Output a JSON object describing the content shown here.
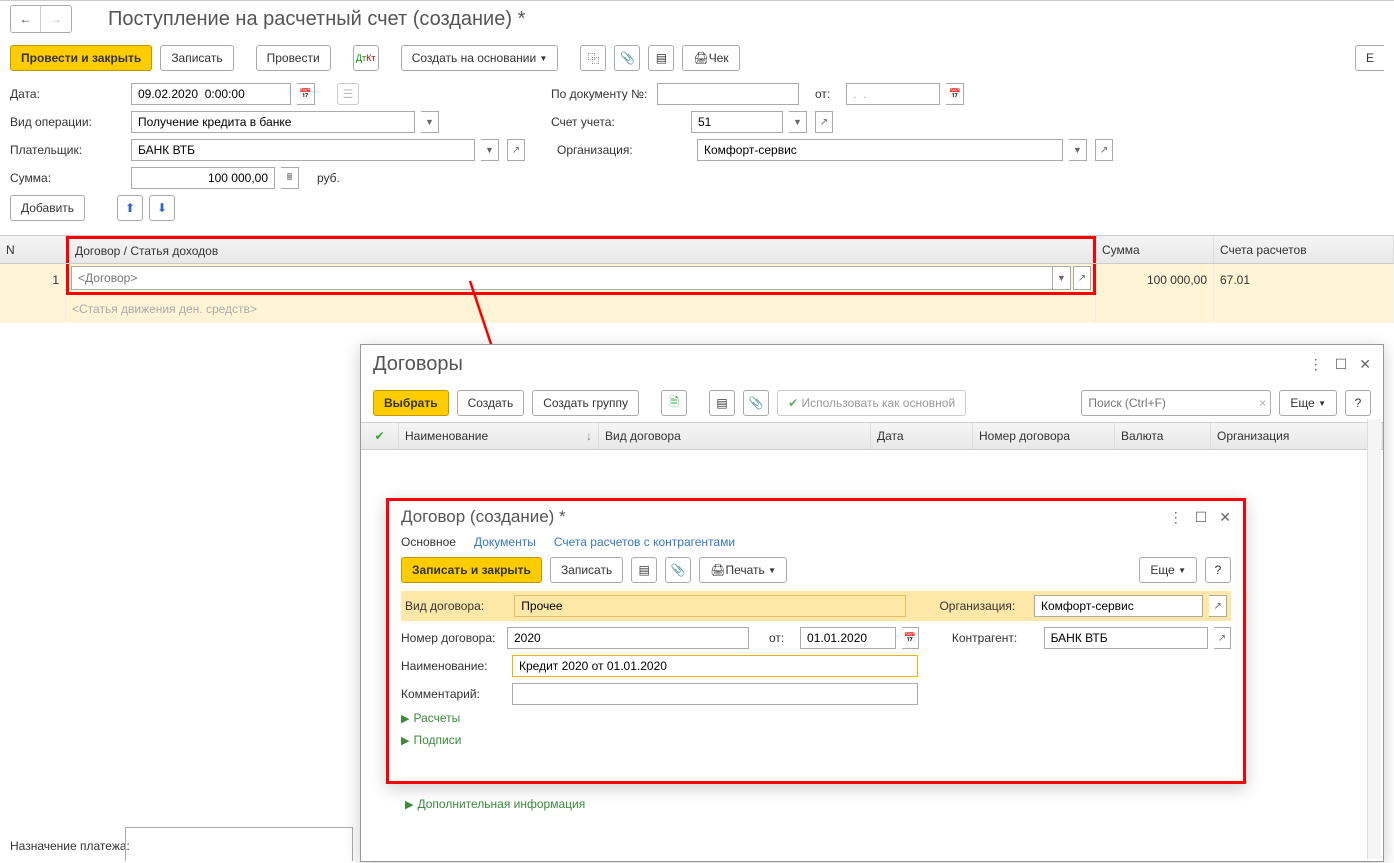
{
  "header": {
    "title": "Поступление на расчетный счет (создание) *"
  },
  "toolbar": {
    "post_close": "Провести и закрыть",
    "write": "Записать",
    "post": "Провести",
    "create_base": "Создать на основании",
    "check": "Чек",
    "more": "Е"
  },
  "form": {
    "date_lbl": "Дата:",
    "date_val": "09.02.2020  0:00:00",
    "doc_num_lbl": "По документу №:",
    "doc_num_val": "",
    "from_lbl": "от:",
    "from_val": ".  .",
    "op_lbl": "Вид операции:",
    "op_val": "Получение кредита в банке",
    "acc_lbl": "Счет учета:",
    "acc_val": "51",
    "payer_lbl": "Плательщик:",
    "payer_val": "БАНК ВТБ",
    "org_lbl": "Организация:",
    "org_val": "Комфорт-сервис",
    "sum_lbl": "Сумма:",
    "sum_val": "100 000,00",
    "sum_cur": "руб.",
    "add_btn": "Добавить",
    "purpose_lbl": "Назначение платежа:"
  },
  "table": {
    "col_n": "N",
    "col_contract": "Договор / Статья доходов",
    "col_sum": "Сумма",
    "col_acc": "Счета расчетов",
    "row_n": "1",
    "row_contract_ph": "<Договор>",
    "row_flow_ph": "<Статья движения ден. средств>",
    "row_sum": "100 000,00",
    "row_acc": "67.01"
  },
  "popup1": {
    "title": "Договоры",
    "select": "Выбрать",
    "create": "Создать",
    "create_grp": "Создать группу",
    "use_main": "Использовать как основной",
    "search_ph": "Поиск (Ctrl+F)",
    "more": "Еще",
    "help": "?",
    "col_name": "Наименование",
    "col_type": "Вид договора",
    "col_date": "Дата",
    "col_num": "Номер договора",
    "col_cur": "Валюта",
    "col_org": "Организация"
  },
  "popup2": {
    "title": "Договор (создание) *",
    "tab_main": "Основное",
    "tab_docs": "Документы",
    "tab_acc": "Счета расчетов с контрагентами",
    "save_close": "Записать и закрыть",
    "write": "Записать",
    "print": "Печать",
    "more": "Еще",
    "help": "?",
    "type_lbl": "Вид договора:",
    "type_val": "Прочее",
    "org_lbl": "Организация:",
    "org_val": "Комфорт-сервис",
    "num_lbl": "Номер договора:",
    "num_val": "2020",
    "from_lbl": "от:",
    "from_val": "01.01.2020",
    "contr_lbl": "Контрагент:",
    "contr_val": "БАНК ВТБ",
    "name_lbl": "Наименование:",
    "name_val": "Кредит 2020 от 01.01.2020",
    "comment_lbl": "Комментарий:",
    "sec_calc": "Расчеты",
    "sec_sign": "Подписи",
    "sec_add": "Дополнительная информация"
  }
}
